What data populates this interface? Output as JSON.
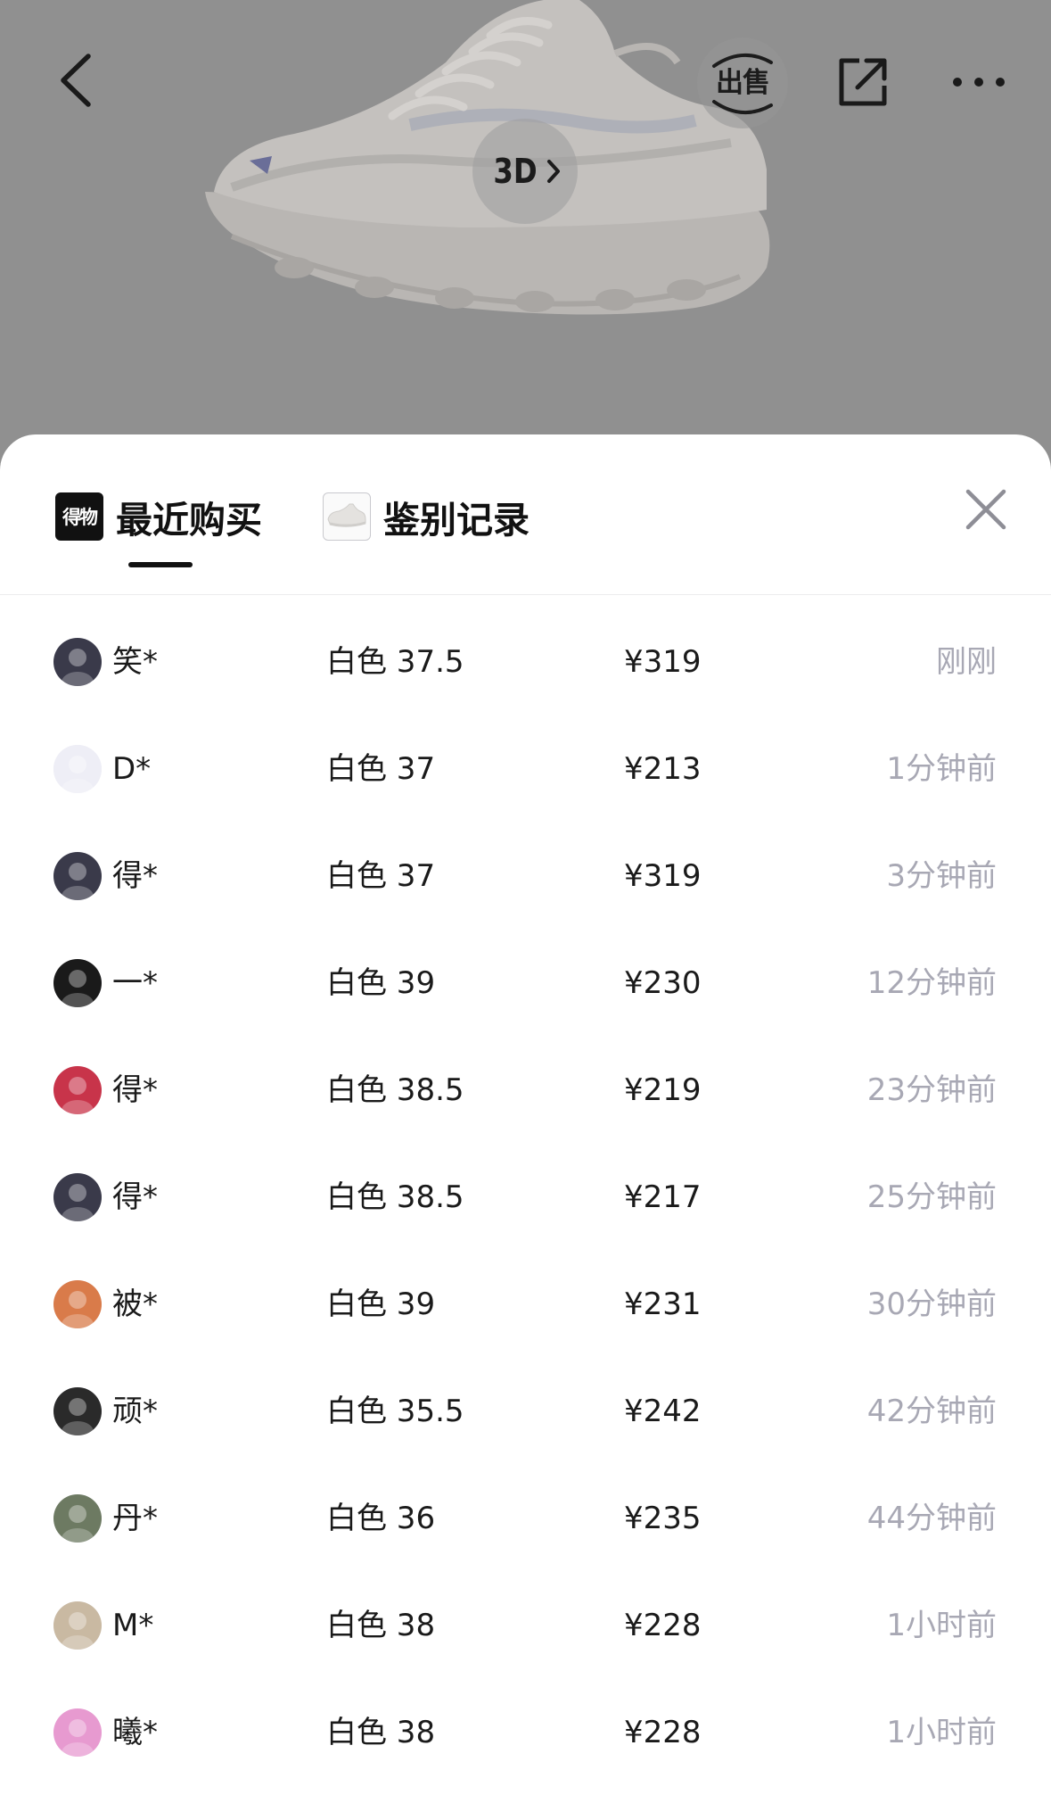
{
  "header": {
    "sell_label": "出售",
    "view_3d_label": "3D"
  },
  "sheet": {
    "tabs": [
      {
        "label": "最近购买",
        "icon": "得物",
        "active": true
      },
      {
        "label": "鉴别记录",
        "active": false
      }
    ]
  },
  "purchases": [
    {
      "name": "笑*",
      "spec": "白色 37.5",
      "price": "¥319",
      "time": "刚刚",
      "avatar_color": "#3a3a4a"
    },
    {
      "name": "D*",
      "spec": "白色 37",
      "price": "¥213",
      "time": "1分钟前",
      "avatar_color": "#eeeef6"
    },
    {
      "name": "得*",
      "spec": "白色 37",
      "price": "¥319",
      "time": "3分钟前",
      "avatar_color": "#3a3a4a"
    },
    {
      "name": "一*",
      "spec": "白色 39",
      "price": "¥230",
      "time": "12分钟前",
      "avatar_color": "#1a1a1a"
    },
    {
      "name": "得*",
      "spec": "白色 38.5",
      "price": "¥219",
      "time": "23分钟前",
      "avatar_color": "#c8344a"
    },
    {
      "name": "得*",
      "spec": "白色 38.5",
      "price": "¥217",
      "time": "25分钟前",
      "avatar_color": "#3a3a4a"
    },
    {
      "name": "被*",
      "spec": "白色 39",
      "price": "¥231",
      "time": "30分钟前",
      "avatar_color": "#d97b4a"
    },
    {
      "name": "顽*",
      "spec": "白色 35.5",
      "price": "¥242",
      "time": "42分钟前",
      "avatar_color": "#2a2a2a"
    },
    {
      "name": "丹*",
      "spec": "白色 36",
      "price": "¥235",
      "time": "44分钟前",
      "avatar_color": "#6d7a62"
    },
    {
      "name": "M*",
      "spec": "白色 38",
      "price": "¥228",
      "time": "1小时前",
      "avatar_color": "#c9b9a2"
    },
    {
      "name": "曦*",
      "spec": "白色 38",
      "price": "¥228",
      "time": "1小时前",
      "avatar_color": "#e79ad0"
    }
  ]
}
